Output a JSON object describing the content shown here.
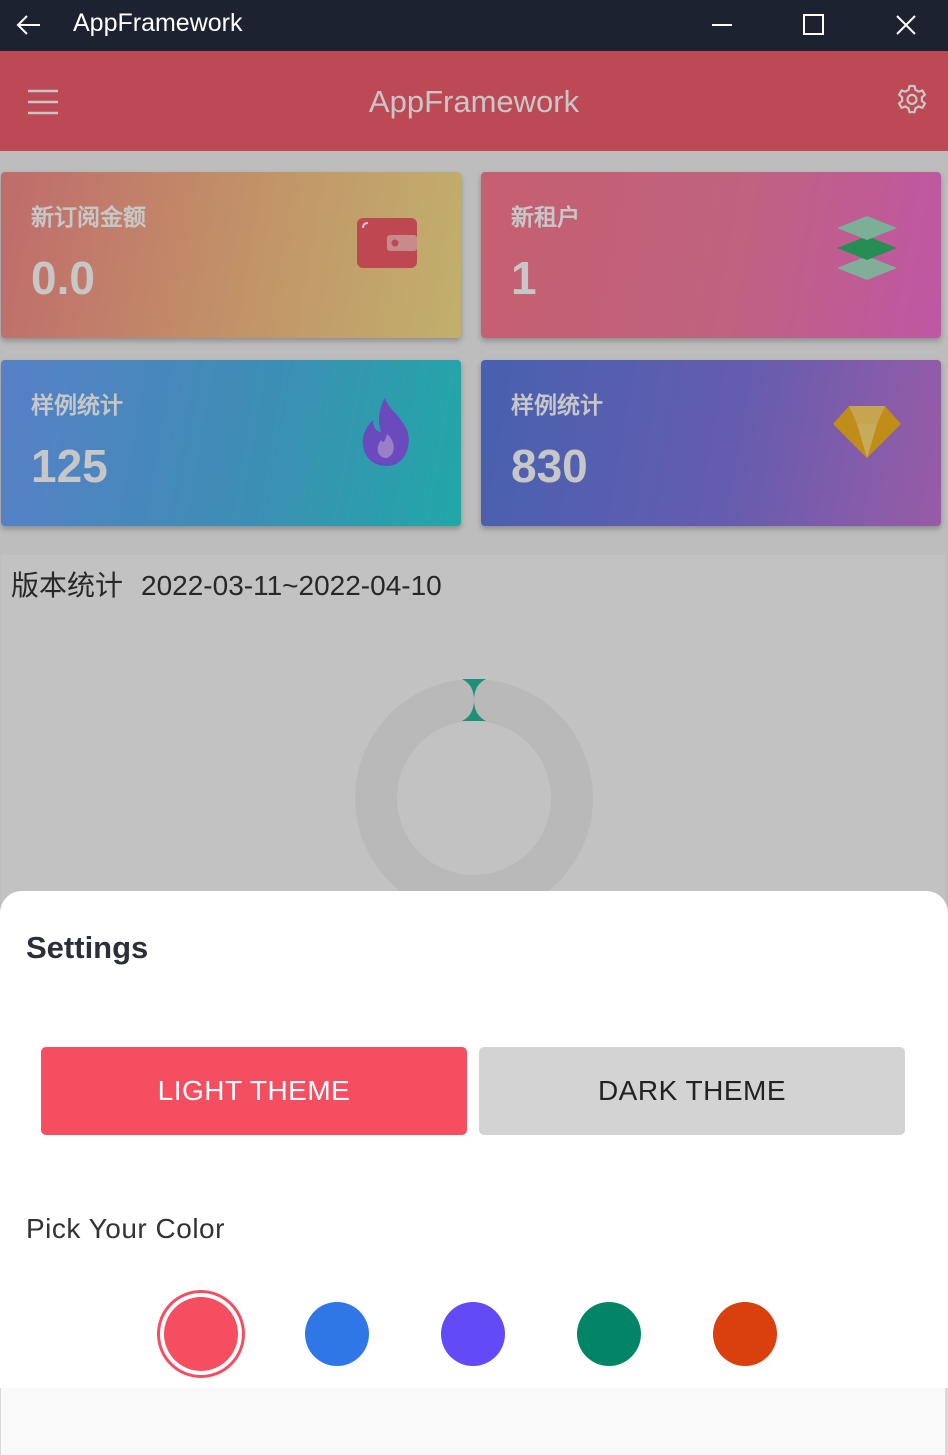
{
  "window": {
    "title": "AppFramework"
  },
  "appbar": {
    "title": "AppFramework",
    "accent": "#f15e6c"
  },
  "cards": [
    {
      "label": "新订阅金额",
      "value": "0.0",
      "icon": "wallet-icon"
    },
    {
      "label": "新租户",
      "value": "1",
      "icon": "layers-icon"
    },
    {
      "label": "样例统计",
      "value": "125",
      "icon": "flame-icon"
    },
    {
      "label": "样例统计",
      "value": "830",
      "icon": "diamond-icon"
    }
  ],
  "version_panel": {
    "title": "版本统计",
    "range": "2022-03-11~2022-04-10"
  },
  "settings": {
    "title": "Settings",
    "light_theme": "LIGHT THEME",
    "dark_theme": "DARK THEME",
    "pick_color": "Pick Your Color",
    "colors": [
      "#f44e60",
      "#2f76e6",
      "#624bf7",
      "#028567",
      "#da3f0e"
    ],
    "selected_color_index": 0
  }
}
